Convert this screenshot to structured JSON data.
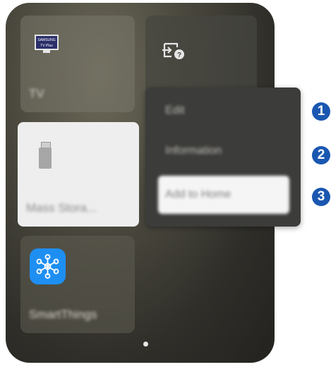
{
  "tiles": {
    "tv": {
      "label": "TV",
      "logo_text": "SAMSUNG TV Plus",
      "icon": "samsung-tv-plus-icon"
    },
    "source": {
      "icon": "source-connection-icon"
    },
    "mass_storage": {
      "label": "Mass Stora...",
      "icon": "usb-drive-icon"
    },
    "smartthings": {
      "label": "SmartThings",
      "icon": "smartthings-icon"
    }
  },
  "context_menu": {
    "items": [
      {
        "label": "Edit"
      },
      {
        "label": "Information"
      },
      {
        "label": "Add to Home",
        "selected": true
      }
    ]
  },
  "callouts": [
    "1",
    "2",
    "3"
  ],
  "colors": {
    "callout": "#1a57b0",
    "smartthings_icon_bg": "#1e8ff2",
    "menu_bg": "#3c3c3a",
    "selected_item_bg": "#f5f5f5"
  },
  "pagination": {
    "pages": 1,
    "current": 1
  }
}
